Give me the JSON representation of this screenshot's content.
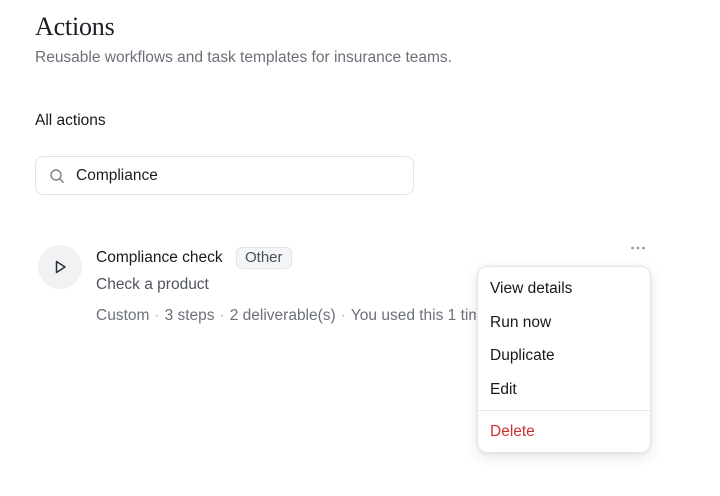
{
  "header": {
    "title": "Actions",
    "subtitle": "Reusable workflows and task templates for insurance teams."
  },
  "section": {
    "heading": "All actions"
  },
  "search": {
    "value": "Compliance",
    "icon": "search-icon"
  },
  "actions": [
    {
      "icon": "play-icon",
      "title": "Compliance check",
      "category": "Other",
      "description": "Check a product",
      "meta": {
        "source": "Custom",
        "steps": "3 steps",
        "deliverables": "2 deliverable(s)",
        "usage": "You used this 1 time"
      }
    }
  ],
  "menu": {
    "trigger_icon": "more-horizontal-icon",
    "items": [
      {
        "label": "View details"
      },
      {
        "label": "Run now"
      },
      {
        "label": "Duplicate"
      },
      {
        "label": "Edit"
      },
      {
        "label": "Delete"
      }
    ]
  },
  "colors": {
    "danger": "#d0302f",
    "muted_text": "#6b7079",
    "border": "#dfe2e6"
  }
}
